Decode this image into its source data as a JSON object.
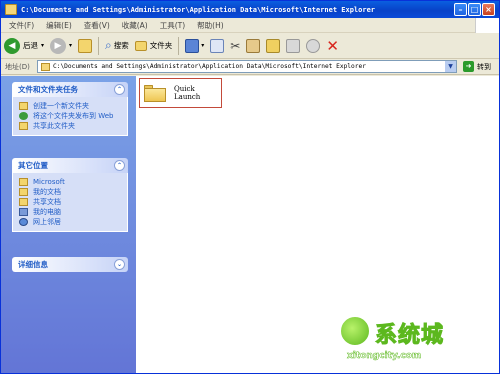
{
  "window": {
    "title": "C:\\Documents and Settings\\Administrator\\Application Data\\Microsoft\\Internet Explorer"
  },
  "menu": [
    "文件(F)",
    "编辑(E)",
    "查看(V)",
    "收藏(A)",
    "工具(T)",
    "帮助(H)"
  ],
  "toolbar": {
    "back": "后退",
    "search": "搜索",
    "folders": "文件夹"
  },
  "address": {
    "label": "地址(D)",
    "path": "C:\\Documents and Settings\\Administrator\\Application Data\\Microsoft\\Internet Explorer",
    "go": "转到"
  },
  "panels": {
    "tasks": {
      "title": "文件和文件夹任务",
      "items": [
        "创建一个新文件夹",
        "将这个文件夹发布到 Web",
        "共享此文件夹"
      ]
    },
    "places": {
      "title": "其它位置",
      "items": [
        "Microsoft",
        "我的文档",
        "共享文档",
        "我的电脑",
        "网上邻居"
      ]
    },
    "details": {
      "title": "详细信息"
    }
  },
  "files": [
    {
      "name": "Quick Launch"
    }
  ],
  "watermark": {
    "brand": "系统城",
    "site": "xitongcity.com"
  },
  "colors": {
    "title_bar": "#0a5fe0",
    "sidebar": "#7ba2e7",
    "link": "#215dc6"
  }
}
